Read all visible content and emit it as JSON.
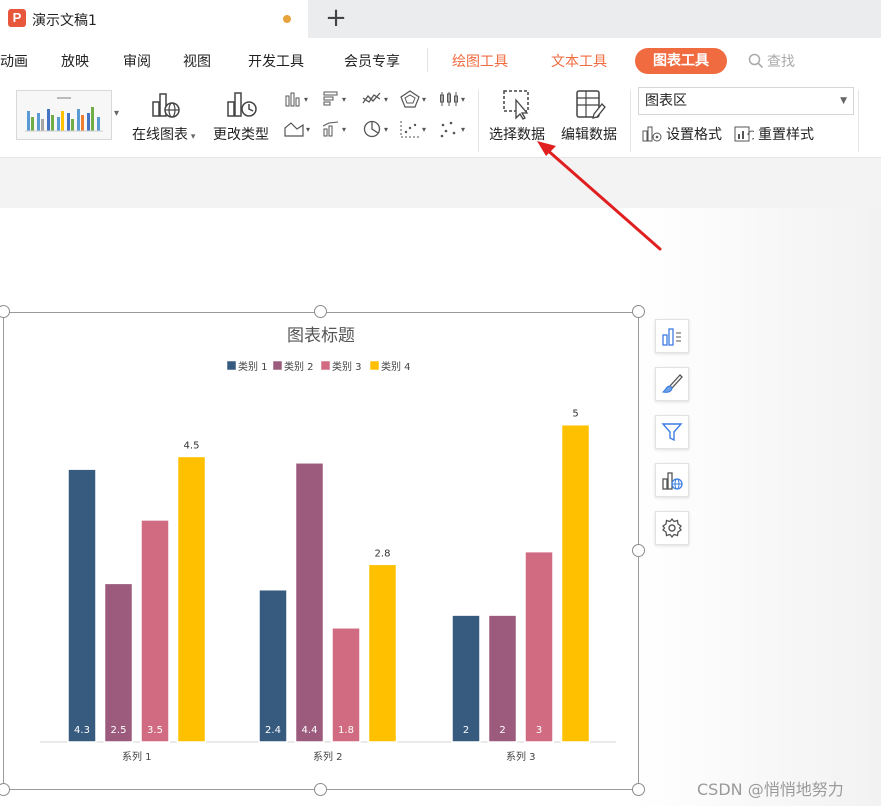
{
  "tab": {
    "app_letter": "P",
    "title": "演示文稿1",
    "new_tab_symbol": "+"
  },
  "menu": {
    "items": [
      "动画",
      "放映",
      "审阅",
      "视图",
      "开发工具",
      "会员专享",
      "绘图工具",
      "文本工具"
    ],
    "active": "图表工具",
    "search_label": "查找"
  },
  "ribbon": {
    "online_chart": "在线图表",
    "change_type": "更改类型",
    "select_data": "选择数据",
    "edit_data": "编辑数据",
    "chart_area_select": "图表区",
    "set_format": "设置格式",
    "reset_style": "重置样式"
  },
  "colors": {
    "accent": "#f06b3f",
    "series_1": "#375a7f",
    "series_2": "#9c5b7c",
    "series_3": "#d06b81",
    "series_4": "#ffc000",
    "arrow": "#e02020"
  },
  "side_tools": [
    "chart-elements-icon",
    "chart-style-icon",
    "chart-filter-icon",
    "online-chart-icon",
    "settings-icon"
  ],
  "watermark": "CSDN @悄悄地努力",
  "chart_data": {
    "type": "bar",
    "title": "图表标题",
    "categories": [
      "系列 1",
      "系列 2",
      "系列 3"
    ],
    "series": [
      {
        "name": "类别 1",
        "values": [
          4.3,
          2.4,
          2
        ]
      },
      {
        "name": "类别 2",
        "values": [
          2.5,
          4.4,
          2
        ]
      },
      {
        "name": "类别 3",
        "values": [
          3.5,
          1.8,
          3
        ]
      },
      {
        "name": "类别 4",
        "values": [
          4.5,
          2.8,
          5
        ]
      }
    ],
    "ylim": [
      0,
      5.5
    ],
    "grid": false,
    "legend": "top"
  }
}
